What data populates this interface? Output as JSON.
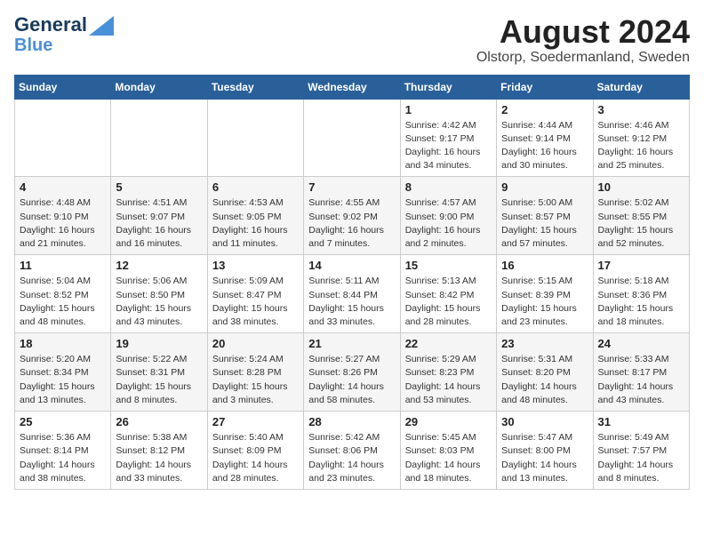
{
  "header": {
    "logo_line1": "General",
    "logo_line2": "Blue",
    "month": "August 2024",
    "location": "Olstorp, Soedermanland, Sweden"
  },
  "weekdays": [
    "Sunday",
    "Monday",
    "Tuesday",
    "Wednesday",
    "Thursday",
    "Friday",
    "Saturday"
  ],
  "weeks": [
    [
      {
        "day": "",
        "info": ""
      },
      {
        "day": "",
        "info": ""
      },
      {
        "day": "",
        "info": ""
      },
      {
        "day": "",
        "info": ""
      },
      {
        "day": "1",
        "info": "Sunrise: 4:42 AM\nSunset: 9:17 PM\nDaylight: 16 hours\nand 34 minutes."
      },
      {
        "day": "2",
        "info": "Sunrise: 4:44 AM\nSunset: 9:14 PM\nDaylight: 16 hours\nand 30 minutes."
      },
      {
        "day": "3",
        "info": "Sunrise: 4:46 AM\nSunset: 9:12 PM\nDaylight: 16 hours\nand 25 minutes."
      }
    ],
    [
      {
        "day": "4",
        "info": "Sunrise: 4:48 AM\nSunset: 9:10 PM\nDaylight: 16 hours\nand 21 minutes."
      },
      {
        "day": "5",
        "info": "Sunrise: 4:51 AM\nSunset: 9:07 PM\nDaylight: 16 hours\nand 16 minutes."
      },
      {
        "day": "6",
        "info": "Sunrise: 4:53 AM\nSunset: 9:05 PM\nDaylight: 16 hours\nand 11 minutes."
      },
      {
        "day": "7",
        "info": "Sunrise: 4:55 AM\nSunset: 9:02 PM\nDaylight: 16 hours\nand 7 minutes."
      },
      {
        "day": "8",
        "info": "Sunrise: 4:57 AM\nSunset: 9:00 PM\nDaylight: 16 hours\nand 2 minutes."
      },
      {
        "day": "9",
        "info": "Sunrise: 5:00 AM\nSunset: 8:57 PM\nDaylight: 15 hours\nand 57 minutes."
      },
      {
        "day": "10",
        "info": "Sunrise: 5:02 AM\nSunset: 8:55 PM\nDaylight: 15 hours\nand 52 minutes."
      }
    ],
    [
      {
        "day": "11",
        "info": "Sunrise: 5:04 AM\nSunset: 8:52 PM\nDaylight: 15 hours\nand 48 minutes."
      },
      {
        "day": "12",
        "info": "Sunrise: 5:06 AM\nSunset: 8:50 PM\nDaylight: 15 hours\nand 43 minutes."
      },
      {
        "day": "13",
        "info": "Sunrise: 5:09 AM\nSunset: 8:47 PM\nDaylight: 15 hours\nand 38 minutes."
      },
      {
        "day": "14",
        "info": "Sunrise: 5:11 AM\nSunset: 8:44 PM\nDaylight: 15 hours\nand 33 minutes."
      },
      {
        "day": "15",
        "info": "Sunrise: 5:13 AM\nSunset: 8:42 PM\nDaylight: 15 hours\nand 28 minutes."
      },
      {
        "day": "16",
        "info": "Sunrise: 5:15 AM\nSunset: 8:39 PM\nDaylight: 15 hours\nand 23 minutes."
      },
      {
        "day": "17",
        "info": "Sunrise: 5:18 AM\nSunset: 8:36 PM\nDaylight: 15 hours\nand 18 minutes."
      }
    ],
    [
      {
        "day": "18",
        "info": "Sunrise: 5:20 AM\nSunset: 8:34 PM\nDaylight: 15 hours\nand 13 minutes."
      },
      {
        "day": "19",
        "info": "Sunrise: 5:22 AM\nSunset: 8:31 PM\nDaylight: 15 hours\nand 8 minutes."
      },
      {
        "day": "20",
        "info": "Sunrise: 5:24 AM\nSunset: 8:28 PM\nDaylight: 15 hours\nand 3 minutes."
      },
      {
        "day": "21",
        "info": "Sunrise: 5:27 AM\nSunset: 8:26 PM\nDaylight: 14 hours\nand 58 minutes."
      },
      {
        "day": "22",
        "info": "Sunrise: 5:29 AM\nSunset: 8:23 PM\nDaylight: 14 hours\nand 53 minutes."
      },
      {
        "day": "23",
        "info": "Sunrise: 5:31 AM\nSunset: 8:20 PM\nDaylight: 14 hours\nand 48 minutes."
      },
      {
        "day": "24",
        "info": "Sunrise: 5:33 AM\nSunset: 8:17 PM\nDaylight: 14 hours\nand 43 minutes."
      }
    ],
    [
      {
        "day": "25",
        "info": "Sunrise: 5:36 AM\nSunset: 8:14 PM\nDaylight: 14 hours\nand 38 minutes."
      },
      {
        "day": "26",
        "info": "Sunrise: 5:38 AM\nSunset: 8:12 PM\nDaylight: 14 hours\nand 33 minutes."
      },
      {
        "day": "27",
        "info": "Sunrise: 5:40 AM\nSunset: 8:09 PM\nDaylight: 14 hours\nand 28 minutes."
      },
      {
        "day": "28",
        "info": "Sunrise: 5:42 AM\nSunset: 8:06 PM\nDaylight: 14 hours\nand 23 minutes."
      },
      {
        "day": "29",
        "info": "Sunrise: 5:45 AM\nSunset: 8:03 PM\nDaylight: 14 hours\nand 18 minutes."
      },
      {
        "day": "30",
        "info": "Sunrise: 5:47 AM\nSunset: 8:00 PM\nDaylight: 14 hours\nand 13 minutes."
      },
      {
        "day": "31",
        "info": "Sunrise: 5:49 AM\nSunset: 7:57 PM\nDaylight: 14 hours\nand 8 minutes."
      }
    ]
  ]
}
